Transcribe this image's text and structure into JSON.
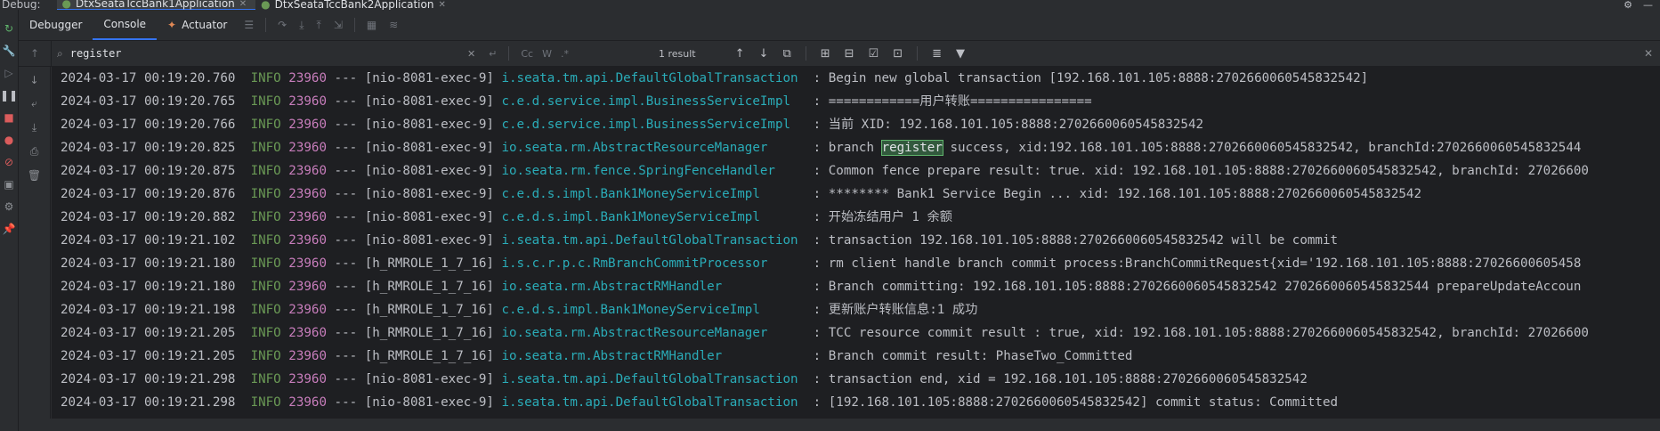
{
  "topbar": {
    "label": "Debug:",
    "tabs": [
      {
        "label": "DtxSeataTccBank1Application",
        "active": true
      },
      {
        "label": "DtxSeataTccBank2Application",
        "active": false
      }
    ]
  },
  "tabs": [
    {
      "label": "Debugger",
      "active": false
    },
    {
      "label": "Console",
      "active": true
    },
    {
      "label": "Actuator",
      "active": false
    }
  ],
  "search": {
    "value": "register",
    "result_count": "1 result",
    "case_label": "Cc",
    "word_label": "W",
    "regex_label": ".*"
  },
  "colors": {
    "level": "#6a9955",
    "pid": "#c77dbb",
    "logger": "#2aacb8",
    "highlight": "#32593d"
  },
  "log": [
    {
      "ts": "2024-03-17 00:19:20.760",
      "level": "INFO",
      "pid": "23960",
      "thread": "--- [nio-8081-exec-9]",
      "logger": "i.seata.tm.api.DefaultGlobalTransaction ",
      "sep": " : ",
      "msg": "Begin new global transaction [192.168.101.105:8888:2702660060545832542]"
    },
    {
      "ts": "2024-03-17 00:19:20.765",
      "level": "INFO",
      "pid": "23960",
      "thread": "--- [nio-8081-exec-9]",
      "logger": "c.e.d.service.impl.BusinessServiceImpl  ",
      "sep": " : ",
      "msg": "============用户转账================"
    },
    {
      "ts": "2024-03-17 00:19:20.766",
      "level": "INFO",
      "pid": "23960",
      "thread": "--- [nio-8081-exec-9]",
      "logger": "c.e.d.service.impl.BusinessServiceImpl  ",
      "sep": " : ",
      "msg": "当前 XID: 192.168.101.105:8888:2702660060545832542"
    },
    {
      "ts": "2024-03-17 00:19:20.825",
      "level": "INFO",
      "pid": "23960",
      "thread": "--- [nio-8081-exec-9]",
      "logger": "io.seata.rm.AbstractResourceManager     ",
      "sep": " : ",
      "msg_pre": "branch ",
      "msg_hl": "register",
      "msg": " success, xid:192.168.101.105:8888:2702660060545832542, branchId:2702660060545832544"
    },
    {
      "ts": "2024-03-17 00:19:20.875",
      "level": "INFO",
      "pid": "23960",
      "thread": "--- [nio-8081-exec-9]",
      "logger": "io.seata.rm.fence.SpringFenceHandler    ",
      "sep": " : ",
      "msg": "Common fence prepare result: true. xid: 192.168.101.105:8888:2702660060545832542, branchId: 27026600"
    },
    {
      "ts": "2024-03-17 00:19:20.876",
      "level": "INFO",
      "pid": "23960",
      "thread": "--- [nio-8081-exec-9]",
      "logger": "c.e.d.s.impl.Bank1MoneyServiceImpl      ",
      "sep": " : ",
      "msg": "******** Bank1 Service Begin ... xid: 192.168.101.105:8888:2702660060545832542"
    },
    {
      "ts": "2024-03-17 00:19:20.882",
      "level": "INFO",
      "pid": "23960",
      "thread": "--- [nio-8081-exec-9]",
      "logger": "c.e.d.s.impl.Bank1MoneyServiceImpl      ",
      "sep": " : ",
      "msg": "开始冻结用户 1 余额"
    },
    {
      "ts": "2024-03-17 00:19:21.102",
      "level": "INFO",
      "pid": "23960",
      "thread": "--- [nio-8081-exec-9]",
      "logger": "i.seata.tm.api.DefaultGlobalTransaction ",
      "sep": " : ",
      "msg": "transaction 192.168.101.105:8888:2702660060545832542 will be commit"
    },
    {
      "ts": "2024-03-17 00:19:21.180",
      "level": "INFO",
      "pid": "23960",
      "thread": "--- [h_RMROLE_1_7_16]",
      "logger": "i.s.c.r.p.c.RmBranchCommitProcessor     ",
      "sep": " : ",
      "msg": "rm client handle branch commit process:BranchCommitRequest{xid='192.168.101.105:8888:27026600605458"
    },
    {
      "ts": "2024-03-17 00:19:21.180",
      "level": "INFO",
      "pid": "23960",
      "thread": "--- [h_RMROLE_1_7_16]",
      "logger": "io.seata.rm.AbstractRMHandler           ",
      "sep": " : ",
      "msg": "Branch committing: 192.168.101.105:8888:2702660060545832542 2702660060545832544 prepareUpdateAccoun"
    },
    {
      "ts": "2024-03-17 00:19:21.198",
      "level": "INFO",
      "pid": "23960",
      "thread": "--- [h_RMROLE_1_7_16]",
      "logger": "c.e.d.s.impl.Bank1MoneyServiceImpl      ",
      "sep": " : ",
      "msg": "更新账户转账信息:1 成功"
    },
    {
      "ts": "2024-03-17 00:19:21.205",
      "level": "INFO",
      "pid": "23960",
      "thread": "--- [h_RMROLE_1_7_16]",
      "logger": "io.seata.rm.AbstractResourceManager     ",
      "sep": " : ",
      "msg": "TCC resource commit result : true, xid: 192.168.101.105:8888:2702660060545832542, branchId: 27026600"
    },
    {
      "ts": "2024-03-17 00:19:21.205",
      "level": "INFO",
      "pid": "23960",
      "thread": "--- [h_RMROLE_1_7_16]",
      "logger": "io.seata.rm.AbstractRMHandler           ",
      "sep": " : ",
      "msg": "Branch commit result: PhaseTwo_Committed"
    },
    {
      "ts": "2024-03-17 00:19:21.298",
      "level": "INFO",
      "pid": "23960",
      "thread": "--- [nio-8081-exec-9]",
      "logger": "i.seata.tm.api.DefaultGlobalTransaction ",
      "sep": " : ",
      "msg": "transaction end, xid = 192.168.101.105:8888:2702660060545832542"
    },
    {
      "ts": "2024-03-17 00:19:21.298",
      "level": "INFO",
      "pid": "23960",
      "thread": "--- [nio-8081-exec-9]",
      "logger": "i.seata.tm.api.DefaultGlobalTransaction ",
      "sep": " : ",
      "msg": "[192.168.101.105:8888:2702660060545832542] commit status: Committed"
    }
  ]
}
